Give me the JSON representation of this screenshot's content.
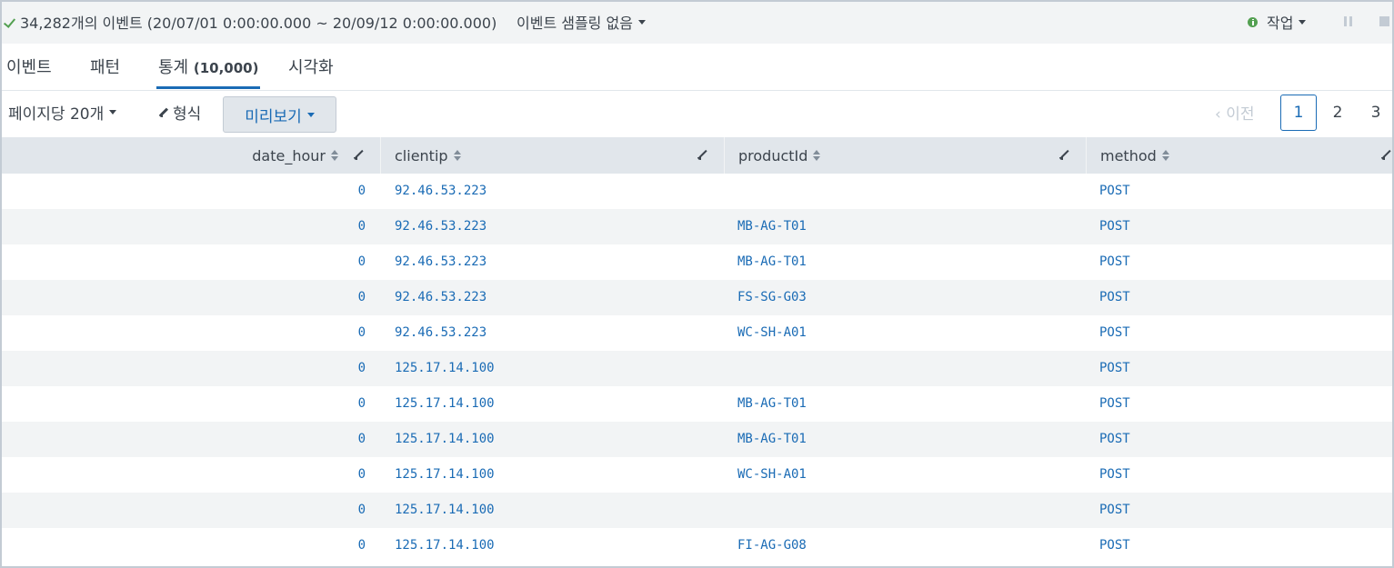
{
  "status": {
    "event_count_text": "34,282개의 이벤트 (20/07/01 0:00:00.000 ~ 20/09/12 0:00:00.000)",
    "sampling_label": "이벤트 샘플링 없음",
    "job_label": "작업"
  },
  "tabs": [
    {
      "label": "이벤트",
      "count": ""
    },
    {
      "label": "패턴",
      "count": ""
    },
    {
      "label": "통계",
      "count": "(10,000)"
    },
    {
      "label": "시각화",
      "count": ""
    }
  ],
  "toolbar": {
    "per_page_label": "페이지당 20개",
    "format_label": "형식",
    "preview_label": "미리보기",
    "prev_label": "이전",
    "pages": [
      "1",
      "2",
      "3"
    ],
    "current_page": "1"
  },
  "table": {
    "columns": [
      "date_hour",
      "clientip",
      "productId",
      "method"
    ],
    "rows": [
      {
        "date_hour": "0",
        "clientip": "92.46.53.223",
        "productId": "",
        "method": "POST"
      },
      {
        "date_hour": "0",
        "clientip": "92.46.53.223",
        "productId": "MB-AG-T01",
        "method": "POST"
      },
      {
        "date_hour": "0",
        "clientip": "92.46.53.223",
        "productId": "MB-AG-T01",
        "method": "POST"
      },
      {
        "date_hour": "0",
        "clientip": "92.46.53.223",
        "productId": "FS-SG-G03",
        "method": "POST"
      },
      {
        "date_hour": "0",
        "clientip": "92.46.53.223",
        "productId": "WC-SH-A01",
        "method": "POST"
      },
      {
        "date_hour": "0",
        "clientip": "125.17.14.100",
        "productId": "",
        "method": "POST"
      },
      {
        "date_hour": "0",
        "clientip": "125.17.14.100",
        "productId": "MB-AG-T01",
        "method": "POST"
      },
      {
        "date_hour": "0",
        "clientip": "125.17.14.100",
        "productId": "MB-AG-T01",
        "method": "POST"
      },
      {
        "date_hour": "0",
        "clientip": "125.17.14.100",
        "productId": "WC-SH-A01",
        "method": "POST"
      },
      {
        "date_hour": "0",
        "clientip": "125.17.14.100",
        "productId": "",
        "method": "POST"
      },
      {
        "date_hour": "0",
        "clientip": "125.17.14.100",
        "productId": "FI-AG-G08",
        "method": "POST"
      }
    ]
  },
  "colors": {
    "accent": "#1a6bb5",
    "success": "#53a051",
    "header_bg": "#e1e6eb",
    "stripe_bg": "#f2f4f5"
  }
}
